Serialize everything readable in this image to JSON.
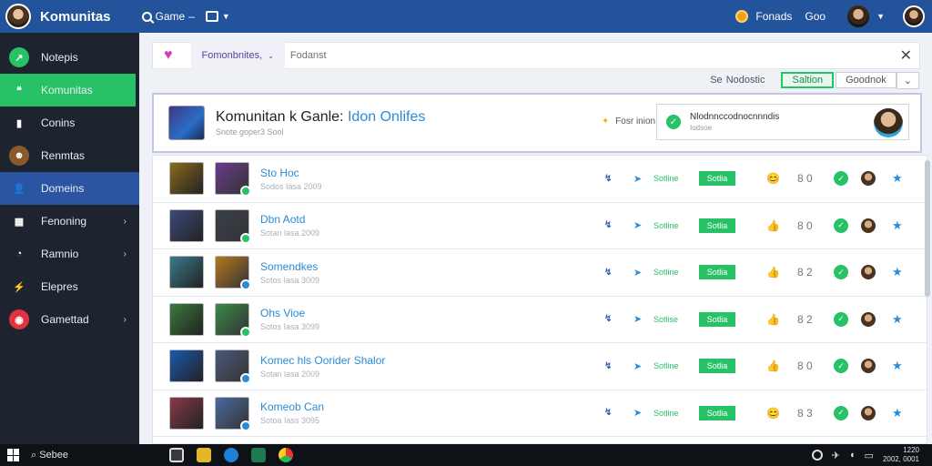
{
  "header": {
    "app_title": "Komunitas",
    "search_label": "Game",
    "points_label": "Fonads",
    "more_label": "Goo"
  },
  "sidebar": {
    "items": [
      {
        "label": "Notepis",
        "icon": "arrow-icon",
        "color": "#27c266",
        "chevron": false,
        "state": ""
      },
      {
        "label": "Komunitas",
        "icon": "chat-icon",
        "color": "#27c266",
        "chevron": false,
        "state": "active-green"
      },
      {
        "label": "Conins",
        "icon": "book-icon",
        "color": "#1d2430",
        "chevron": false,
        "state": ""
      },
      {
        "label": "Renmtas",
        "icon": "avatar-icon",
        "color": "#8a5a2b",
        "chevron": false,
        "state": ""
      },
      {
        "label": "Domeins",
        "icon": "user-icon",
        "color": "#2b55a3",
        "chevron": false,
        "state": "active-blue"
      },
      {
        "label": "Fenoning",
        "icon": "grid-icon",
        "color": "#1d2430",
        "chevron": true,
        "state": ""
      },
      {
        "label": "Ramnio",
        "icon": "chat-bubble-icon",
        "color": "#1d2430",
        "chevron": true,
        "state": ""
      },
      {
        "label": "Elepres",
        "icon": "bolt-icon",
        "color": "#1d2430",
        "chevron": false,
        "state": ""
      },
      {
        "label": "Gamettad",
        "icon": "record-icon",
        "color": "#e0323f",
        "chevron": true,
        "state": ""
      }
    ]
  },
  "filter": {
    "tab_label": "Fomonbnites,",
    "search_value": "Fodanst"
  },
  "subbar": {
    "label": "Nodostic",
    "prefix": "Se",
    "online_button": "Saltion",
    "other_button": "Goodnok"
  },
  "hero": {
    "title": "Komunitan k Ganle:",
    "title_tag": "Idon Onlifes",
    "subtitle": "Snote goper3 Sool",
    "status": "Fosr inion",
    "notice_title": "Nlodnnccodnocnnndis",
    "notice_sub": "Iodsoe"
  },
  "rows": [
    {
      "name": "Sto Hoc",
      "meta": "Sodos Iasa 2009",
      "status": "Sotline",
      "badge": "Sotlia",
      "emoji": "😊",
      "count": "8 0",
      "mini": "green",
      "c1": "#8a6a1d",
      "c2": "#6b3a8e"
    },
    {
      "name": "Dbn Aotd",
      "meta": "Sotan lasa 2009",
      "status": "Sotline",
      "badge": "Sotlia",
      "emoji": "👍",
      "count": "8 0",
      "mini": "green",
      "c1": "#3d4a7a",
      "c2": "#3a3f4a"
    },
    {
      "name": "Somendkes",
      "meta": "Sotos Iasa 3009",
      "status": "Sotline",
      "badge": "Sotlia",
      "emoji": "👍",
      "count": "8 2",
      "mini": "blue",
      "c1": "#3a7a8c",
      "c2": "#b5781e"
    },
    {
      "name": "Ohs Vioe",
      "meta": "Sotos Iasa 3099",
      "status": "Sotlise",
      "badge": "Sotlia",
      "emoji": "👍",
      "count": "8 2",
      "mini": "green",
      "c1": "#3a7a3f",
      "c2": "#3a8a4a"
    },
    {
      "name": "Komec hls Oorider Shalor",
      "meta": "Sotan lasa 2009",
      "status": "Sotline",
      "badge": "Sotlia",
      "emoji": "👍",
      "count": "8 0",
      "mini": "blue",
      "c1": "#1a5ab0",
      "c2": "#4a5a7a"
    },
    {
      "name": "Komeob Can",
      "meta": "Sotoa Iass 3095",
      "status": "Sotline",
      "badge": "Sotlia",
      "emoji": "😊",
      "count": "8 3",
      "mini": "blue",
      "c1": "#8a3a4a",
      "c2": "#4a6aa0"
    }
  ],
  "taskbar": {
    "search": "Sebee",
    "clock_time": "1220",
    "clock_date": "2002, 0001"
  },
  "colors": {
    "brand": "#23539b",
    "accent_green": "#27c266",
    "link_blue": "#2a8bd6"
  }
}
